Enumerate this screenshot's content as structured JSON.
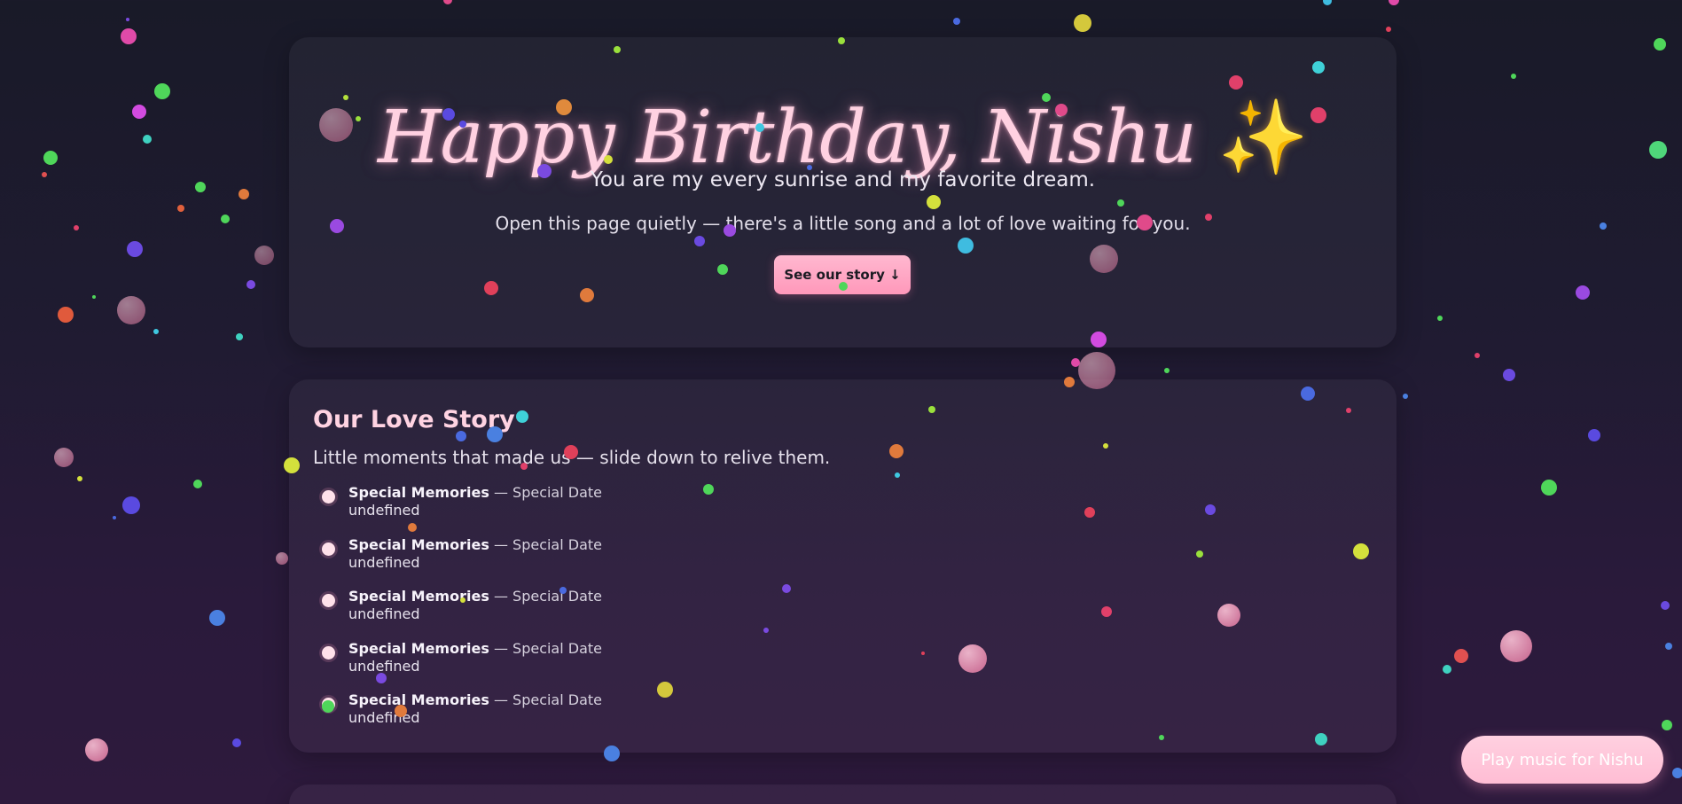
{
  "hero": {
    "title": "Happy Birthday, Nishu",
    "title_emoji": "✨",
    "subtitle": "You are my every sunrise and my favorite dream.",
    "note": "Open this page quietly — there's a little song and a lot of love waiting for you.",
    "cta_label": "See our story ↓"
  },
  "story": {
    "title": "Our Love Story",
    "subtitle": "Little moments that made us — slide down to relive them.",
    "items": [
      {
        "title": "Special Memories",
        "separator": "—",
        "date": "Special Date",
        "description": "undefined"
      },
      {
        "title": "Special Memories",
        "separator": "—",
        "date": "Special Date",
        "description": "undefined"
      },
      {
        "title": "Special Memories",
        "separator": "—",
        "date": "Special Date",
        "description": "undefined"
      },
      {
        "title": "Special Memories",
        "separator": "—",
        "date": "Special Date",
        "description": "undefined"
      },
      {
        "title": "Special Memories",
        "separator": "—",
        "date": "Special Date",
        "description": "undefined"
      }
    ]
  },
  "music": {
    "button_label": "Play music for Nishu"
  },
  "colors": {
    "accent_pink": "#ff98ba",
    "title_pink": "#ffd1e1",
    "sparkle_gold": "#ffb548",
    "background_top": "#191a28",
    "background_bottom": "#2e1a3d"
  }
}
